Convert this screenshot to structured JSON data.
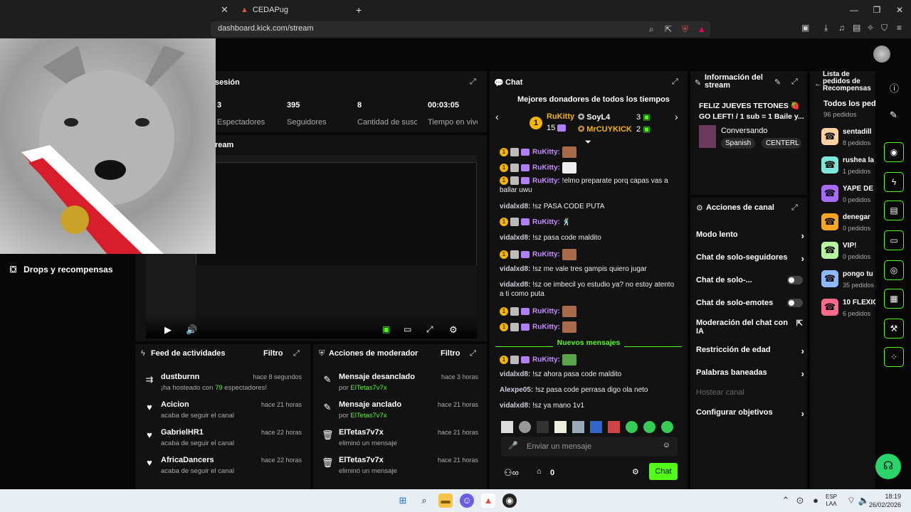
{
  "browser": {
    "tab_title": "CEDAPug",
    "url": "dashboard.kick.com/stream"
  },
  "session": {
    "title": "sesión",
    "stats": [
      {
        "value": "3",
        "label": "Espectadores"
      },
      {
        "value": "395",
        "label": "Seguidores"
      },
      {
        "value": "8",
        "label": "Cantidad de suscripciones"
      },
      {
        "value": "00:03:05",
        "label": "Tiempo en vivo"
      }
    ],
    "stream_label": "ream"
  },
  "sidebar": {
    "drops_label": "Drops y recompensas"
  },
  "activity_feed": {
    "title": "Feed de actividades",
    "filter": "Filtro",
    "items": [
      {
        "name": "dustburnn",
        "time": "hace 8 segundos",
        "detail_prefix": "¡ha hosteado con ",
        "detail_count": "79",
        "detail_suffix": " espectadores!",
        "icon": "host-icon"
      },
      {
        "name": "Acicion",
        "time": "hace 21 horas",
        "detail": "acaba de seguir el canal",
        "icon": "heart-icon"
      },
      {
        "name": "GabrielHR1",
        "time": "hace 22 horas",
        "detail": "acaba de seguir el canal",
        "icon": "heart-icon"
      },
      {
        "name": "AfricaDancers",
        "time": "hace 22 horas",
        "detail": "acaba de seguir el canal",
        "icon": "heart-icon"
      }
    ]
  },
  "mod_actions": {
    "title": "Acciones de moderador",
    "filter": "Filtro",
    "items": [
      {
        "name": "Mensaje desanclado",
        "time": "hace 3 horas",
        "by_prefix": "por ",
        "by": "ElTetas7v7x"
      },
      {
        "name": "Mensaje anclado",
        "time": "hace 21 horas",
        "by_prefix": "por ",
        "by": "ElTetas7v7x"
      },
      {
        "name": "ElTetas7v7x",
        "time": "hace 21 horas",
        "detail": "eliminó un mensaje"
      },
      {
        "name": "ElTetas7v7x",
        "time": "hace 21 horas",
        "detail": "eliminó un mensaje"
      }
    ]
  },
  "chat": {
    "title": "Chat",
    "top_donors_title": "Mejores donadores de todos los tiempos",
    "donors": [
      {
        "name": "RuKitty",
        "count": "15",
        "rank": "1"
      },
      {
        "name": "SoyL4",
        "count": "3"
      },
      {
        "name": "MrCUYKICK",
        "count": "2"
      }
    ],
    "messages": [
      {
        "user": "RuKitty:",
        "text": "",
        "badges": true,
        "emote": true
      },
      {
        "user": "RuKitty:",
        "text": "",
        "badges": true,
        "emote": true
      },
      {
        "user": "RuKitty:",
        "text": "!elmo preparate porq capas vas a ballar uwu",
        "badges": true
      },
      {
        "user": "vidalxd8:",
        "text": "!sz PASA CODE PUTA"
      },
      {
        "user": "RuKitty:",
        "text": "",
        "badges": true,
        "emote": true
      },
      {
        "user": "vidalxd8:",
        "text": "!sz pasa code maldito"
      },
      {
        "user": "RuKitty:",
        "text": "",
        "badges": true,
        "emote": true
      },
      {
        "user": "vidalxd8:",
        "text": "!sz me vale tres gampis quiero jugar"
      },
      {
        "user": "vidalxd8:",
        "text": "!sz oe imbecil yo estudio ya? no estoy atento a ti como puta"
      },
      {
        "user": "RuKitty:",
        "text": "",
        "badges": true,
        "emote": true
      },
      {
        "user": "RuKitty:",
        "text": "",
        "badges": true,
        "emote": true
      }
    ],
    "new_messages_label": "Nuevos mensajes",
    "new_messages": [
      {
        "user": "RuKitty:",
        "text": "",
        "badges": true,
        "emote": true
      },
      {
        "user": "vidalxd8:",
        "text": "!sz ahora pasa code maldito"
      },
      {
        "user": "Alexpe05:",
        "text": "!sz pasa code perrasa digo ola neto"
      },
      {
        "user": "vidalxd8:",
        "text": "!sz ya mano 1v1"
      }
    ],
    "input_placeholder": "Enviar un mensaje",
    "footer_count": "0",
    "send_label": "Chat"
  },
  "stream_info": {
    "title": "Información del stream",
    "stream_title": "FELIZ JUEVES TETONES 🍓 GO LEFT! / 1 sub = 1 Baile y...",
    "category": "Conversando",
    "tags": [
      "Spanish",
      "CENTERL"
    ]
  },
  "channel_actions": {
    "title": "Acciones de canal",
    "items": [
      {
        "label": "Modo lento",
        "kind": "chevron"
      },
      {
        "label": "Chat de solo-seguidores",
        "kind": "chevron"
      },
      {
        "label": "Chat de solo-...",
        "kind": "toggle"
      },
      {
        "label": "Chat de solo-emotes",
        "kind": "toggle"
      },
      {
        "label": "Moderación del chat con IA",
        "kind": "external"
      },
      {
        "label": "Restricción de edad",
        "kind": "chevron"
      },
      {
        "label": "Palabras baneadas",
        "kind": "chevron"
      },
      {
        "label": "Hostear canal",
        "kind": "disabled"
      },
      {
        "label": "Configurar objetivos",
        "kind": "chevron"
      }
    ]
  },
  "rewards": {
    "title": "Lista de pedidos de Recompensas",
    "all_label": "Todos los pedi",
    "all_count": "96 pedidos",
    "items": [
      {
        "name": "sentadill",
        "count": "8 pedidos",
        "color": "#ffd0a0"
      },
      {
        "name": "rushea la",
        "count": "1 pedidos",
        "color": "#7ee8d8"
      },
      {
        "name": "YAPE DE",
        "count": "0 pedidos",
        "color": "#a86bff"
      },
      {
        "name": "denegar",
        "count": "0 pedidos",
        "color": "#f5a623"
      },
      {
        "name": "VIP!",
        "count": "0 pedidos",
        "color": "#b8f5a0"
      },
      {
        "name": "pongo tu",
        "count": "35 pedidos",
        "color": "#8fb8ff"
      },
      {
        "name": "10 FLEXIO",
        "count": "6 pedidos",
        "color": "#ff6b8a"
      }
    ]
  },
  "taskbar": {
    "lang_top": "ESP",
    "lang_bottom": "LAA",
    "time": "18:19",
    "date": "26/02/2026"
  },
  "colors": {
    "accent": "#53fc18",
    "panel": "#121212",
    "background": "#070707"
  }
}
